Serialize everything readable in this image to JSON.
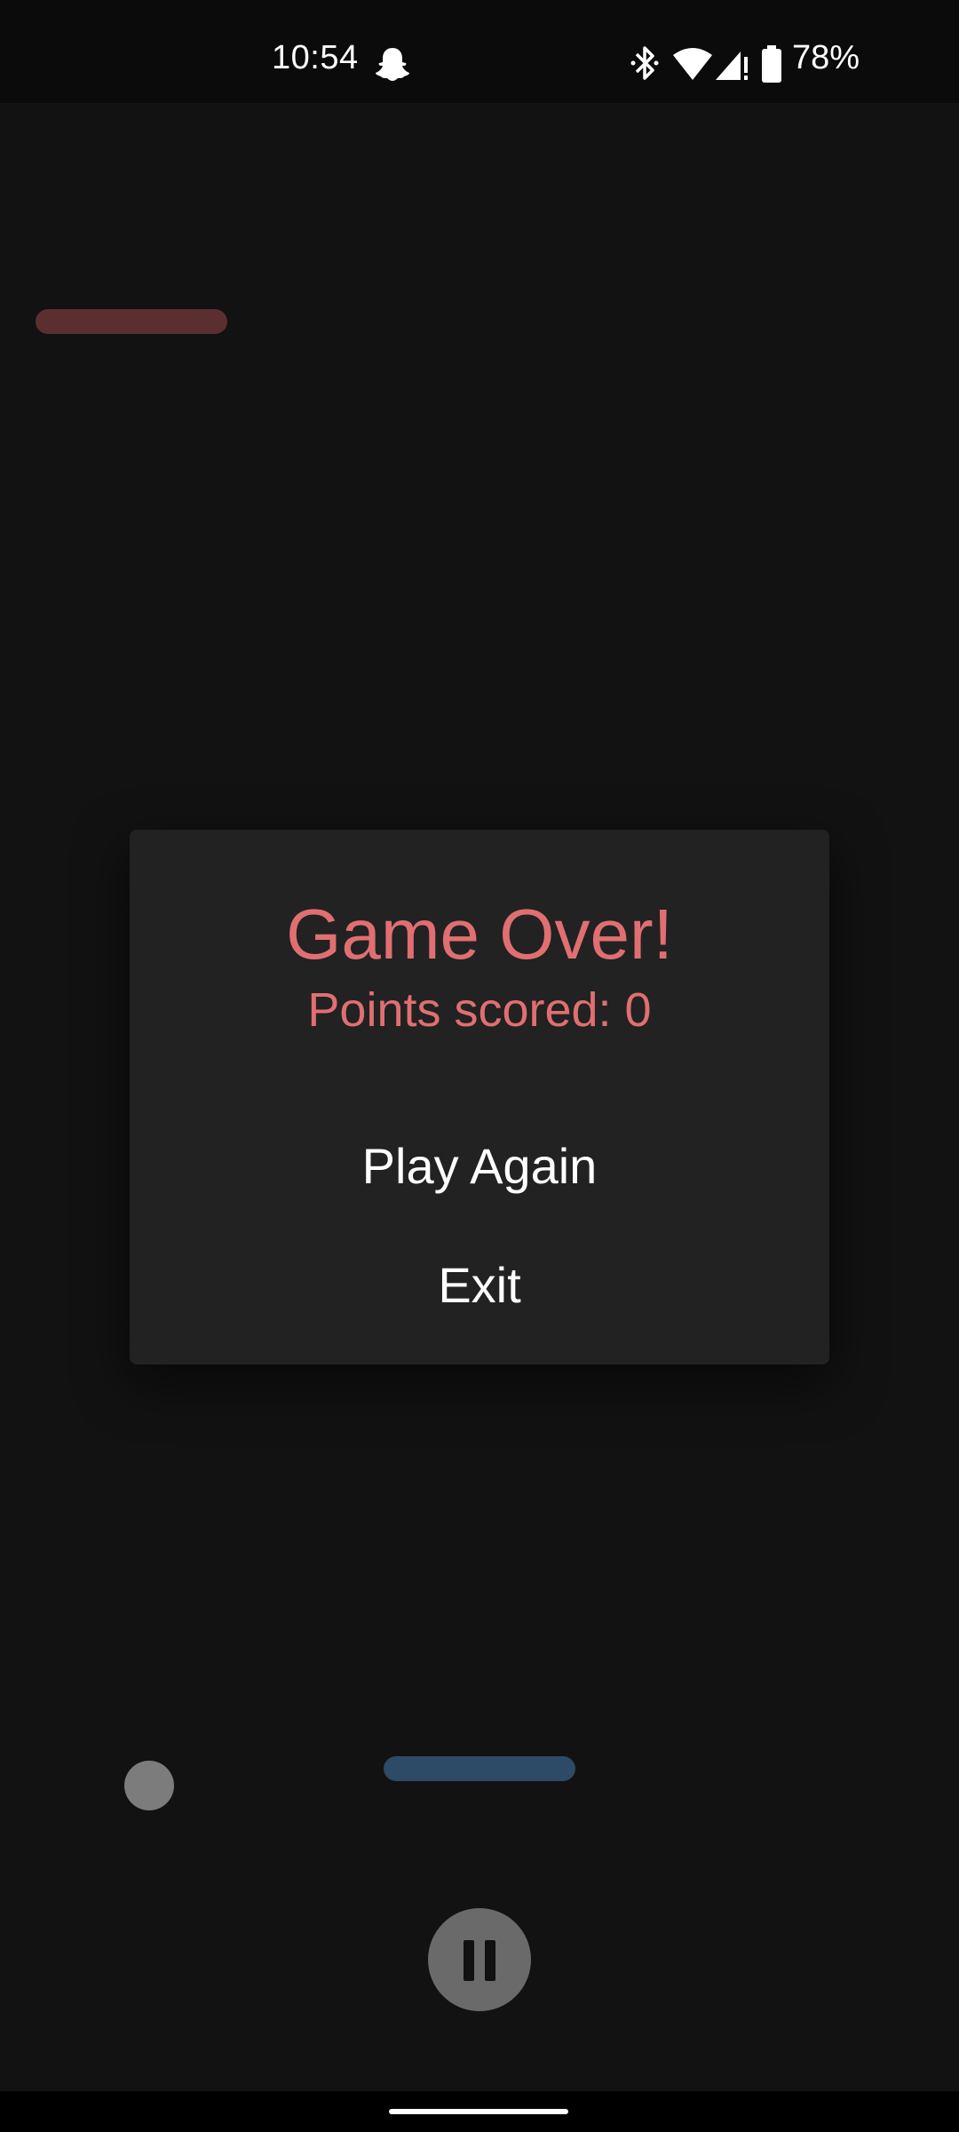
{
  "status_bar": {
    "time": "10:54",
    "battery": "78%",
    "icons": [
      "snapchat-icon",
      "bluetooth-icon",
      "wifi-icon",
      "signal-icon",
      "battery-icon"
    ]
  },
  "game": {
    "opponent_paddle_color": "#5b2f30",
    "player_paddle_color": "#2d4a66",
    "ball_color": "#7c7c7c",
    "pause_icon": "pause-icon"
  },
  "dialog": {
    "title": "Game Over!",
    "score_text": "Points scored: 0",
    "play_again_label": "Play Again",
    "exit_label": "Exit",
    "accent_color": "#e06f72"
  }
}
